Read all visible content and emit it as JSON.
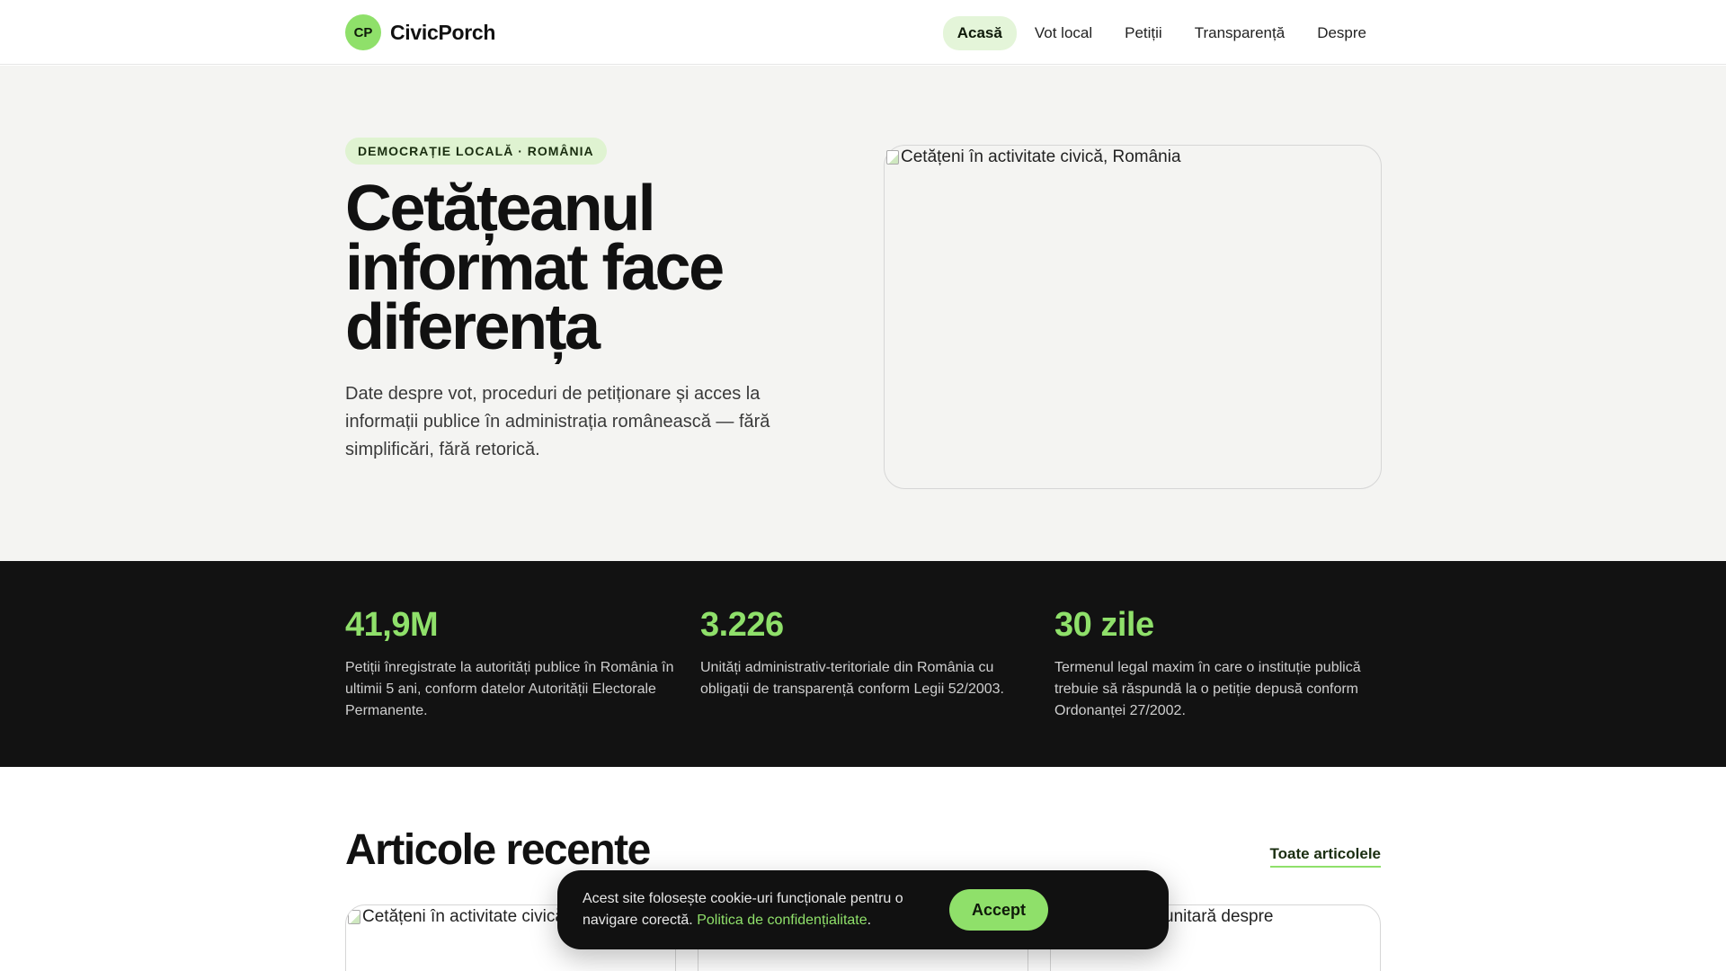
{
  "header": {
    "logo_initials": "CP",
    "logo_text": "CivicPorch",
    "nav": [
      "Acasă",
      "Vot local",
      "Petiții",
      "Transparență",
      "Despre"
    ]
  },
  "hero": {
    "tag": "DEMOCRAȚIE LOCALĂ · ROMÂNIA",
    "title": "Cetățeanul informat face diferența",
    "text": "Date despre vot, proceduri de petiționare și acces la informații publice în administrația românească — fără simplificări, fără retorică.",
    "image_alt": "Cetățeni în activitate civică, România"
  },
  "stats": [
    {
      "value": "41,9M",
      "desc": "Petiții înregistrate la autorități publice în România în ultimii 5 ani, conform datelor Autorității Electorale Permanente."
    },
    {
      "value": "3.226",
      "desc": "Unități administrativ-teritoriale din România cu obligații de transparență conform Legii 52/2003."
    },
    {
      "value": "30 zile",
      "desc": "Termenul legal maxim în care o instituție publică trebuie să răspundă la o petiție depusă conform Ordonanței 27/2002."
    }
  ],
  "articles": {
    "title": "Articole recente",
    "all_link": "Toate articolele",
    "cards": [
      {
        "alt": "Cetățeni în activitate civică"
      },
      {
        "alt": ""
      },
      {
        "alt": "unitară despre"
      }
    ]
  },
  "cookie": {
    "text": "Acest site folosește cookie-uri funcționale pentru o navigare corectă.",
    "link": "Politica de confidențialitate",
    "accept": "Accept"
  },
  "colors": {
    "accent": "#8fe06a",
    "dark": "#121212",
    "hero_bg": "#f4f4f2"
  }
}
